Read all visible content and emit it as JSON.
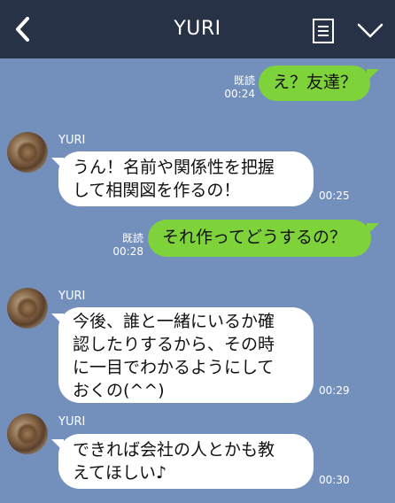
{
  "header": {
    "title": "YURI",
    "back_icon": "chevron-left-icon",
    "notes_icon": "notes-icon",
    "menu_icon": "chevron-down-icon"
  },
  "messages": [
    {
      "side": "right",
      "text": "え？友達？",
      "read": "既読",
      "time": "00:24"
    },
    {
      "side": "left",
      "sender": "YURI",
      "text": "うん！名前や関係性を把握\nして相関図を作るの！",
      "time": "00:25"
    },
    {
      "side": "right",
      "text": "それ作ってどうするの？",
      "read": "既読",
      "time": "00:28"
    },
    {
      "side": "left",
      "sender": "YURI",
      "text": "今後、誰と一緒にいるか確\n認したりするから、その時\nに一目でわかるようにして\nおくの(^^)",
      "time": "00:29"
    },
    {
      "side": "left",
      "sender": "YURI",
      "text": "できれば会社の人とかも教\nえてほしい♪",
      "time": "00:30"
    }
  ],
  "colors": {
    "background": "#7390bd",
    "header": "#273246",
    "outgoing_bubble": "#7fd33a",
    "incoming_bubble": "#ffffff"
  }
}
